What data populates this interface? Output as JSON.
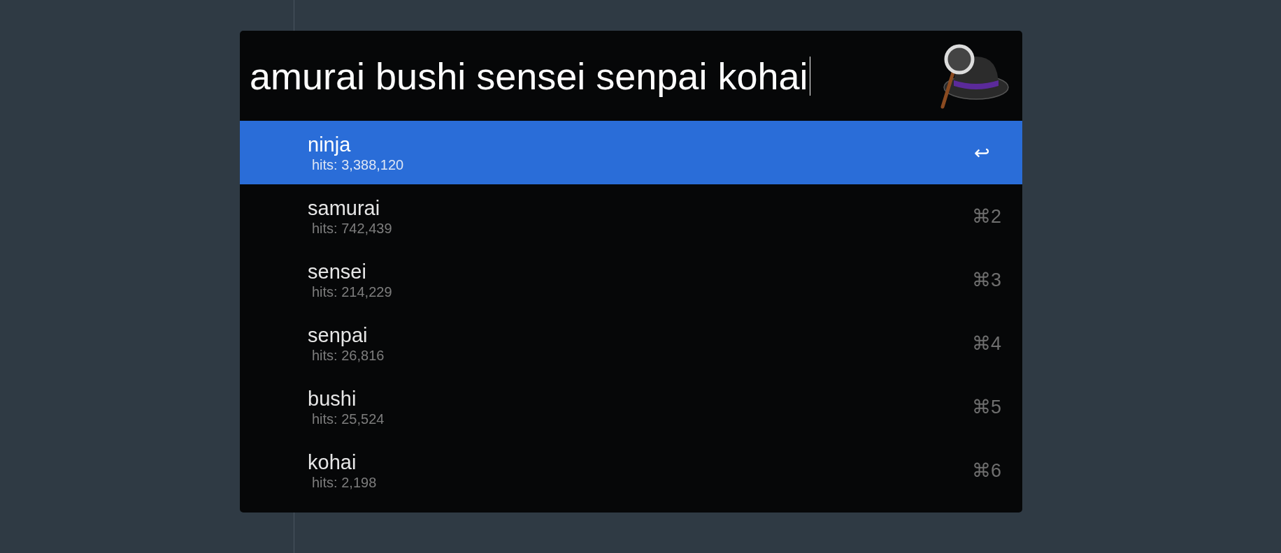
{
  "search": {
    "value": "amurai bushi sensei senpai kohai"
  },
  "results": [
    {
      "title": "ninja",
      "subtitle": "hits: 3,388,120",
      "shortcut": "↩",
      "selected": true
    },
    {
      "title": "samurai",
      "subtitle": "hits: 742,439",
      "shortcut": "⌘2",
      "selected": false
    },
    {
      "title": "sensei",
      "subtitle": "hits: 214,229",
      "shortcut": "⌘3",
      "selected": false
    },
    {
      "title": "senpai",
      "subtitle": "hits: 26,816",
      "shortcut": "⌘4",
      "selected": false
    },
    {
      "title": "bushi",
      "subtitle": "hits: 25,524",
      "shortcut": "⌘5",
      "selected": false
    },
    {
      "title": "kohai",
      "subtitle": "hits: 2,198",
      "shortcut": "⌘6",
      "selected": false
    }
  ]
}
